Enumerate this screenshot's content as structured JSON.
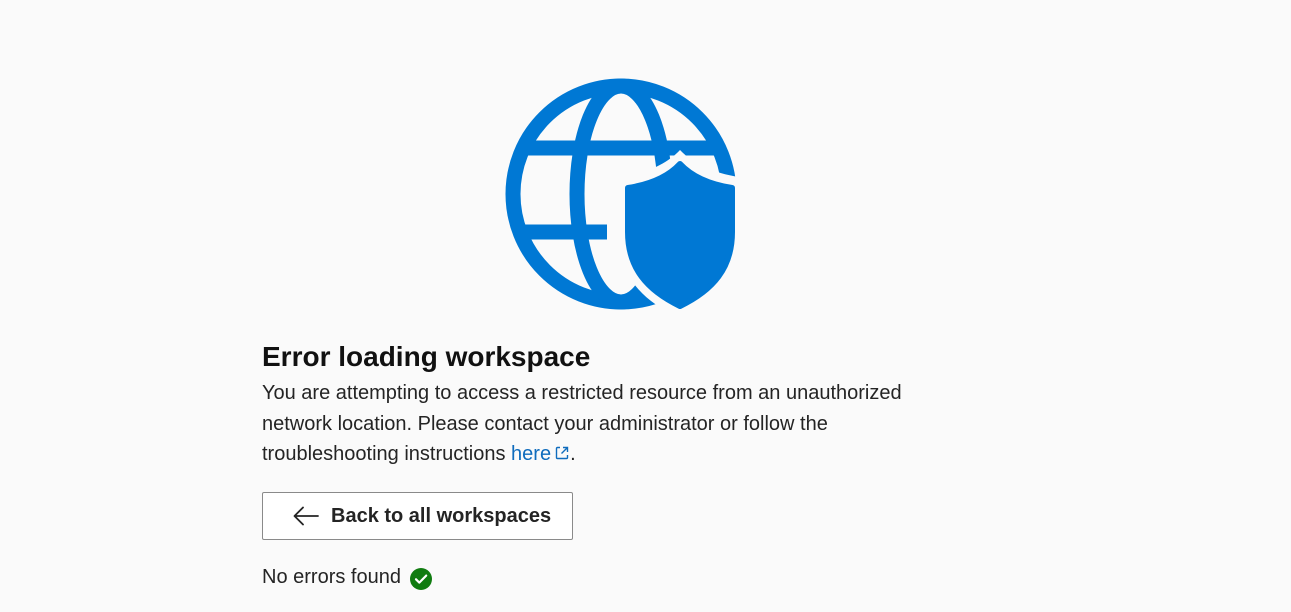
{
  "error_page": {
    "illustration_icon": "globe-shield-icon",
    "accent_color": "#0078d4",
    "title": "Error loading workspace",
    "message_text": "You are attempting to access a restricted resource from an unauthorized network location. Please contact your administrator or follow the troubleshooting instructions ",
    "link_text": "here",
    "link_icon": "external-link-icon",
    "message_end": ".",
    "back_button_label": "Back to all workspaces",
    "back_button_icon": "arrow-left-icon",
    "status_text": "No errors found",
    "status_icon": "check-circle-icon",
    "status_color": "#107c10"
  }
}
